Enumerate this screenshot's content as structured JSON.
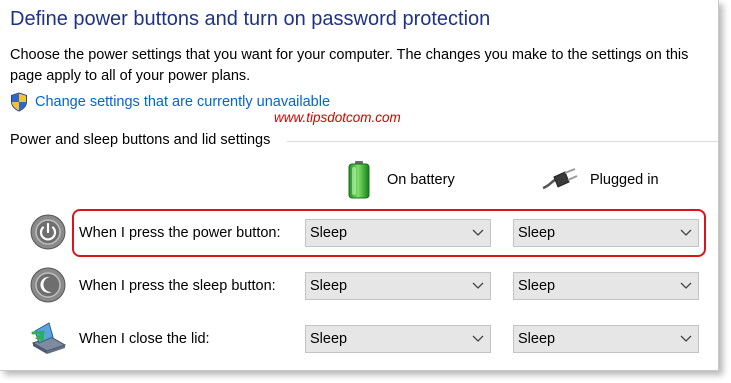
{
  "page": {
    "title": "Define power buttons and turn on password protection",
    "description": "Choose the power settings that you want for your computer. The changes you make to the settings on this page apply to all of your power plans.",
    "change_settings_link": "Change settings that are currently unavailable",
    "watermark": "www.tipsdotcom.com",
    "section_title": "Power and sleep buttons and lid settings"
  },
  "columns": {
    "on_battery": "On battery",
    "plugged_in": "Plugged in"
  },
  "rows": [
    {
      "label": "When I press the power button:",
      "on_battery": "Sleep",
      "plugged_in": "Sleep",
      "icon": "power-button-icon",
      "highlighted": true
    },
    {
      "label": "When I press the sleep button:",
      "on_battery": "Sleep",
      "plugged_in": "Sleep",
      "icon": "sleep-button-icon",
      "highlighted": false
    },
    {
      "label": "When I close the lid:",
      "on_battery": "Sleep",
      "plugged_in": "Sleep",
      "icon": "laptop-lid-icon",
      "highlighted": false
    }
  ],
  "colors": {
    "title": "#1e3287",
    "link": "#0066cc",
    "watermark": "#d40000",
    "highlight": "#d9151b",
    "dropdown_bg": "#e6e6e6"
  }
}
